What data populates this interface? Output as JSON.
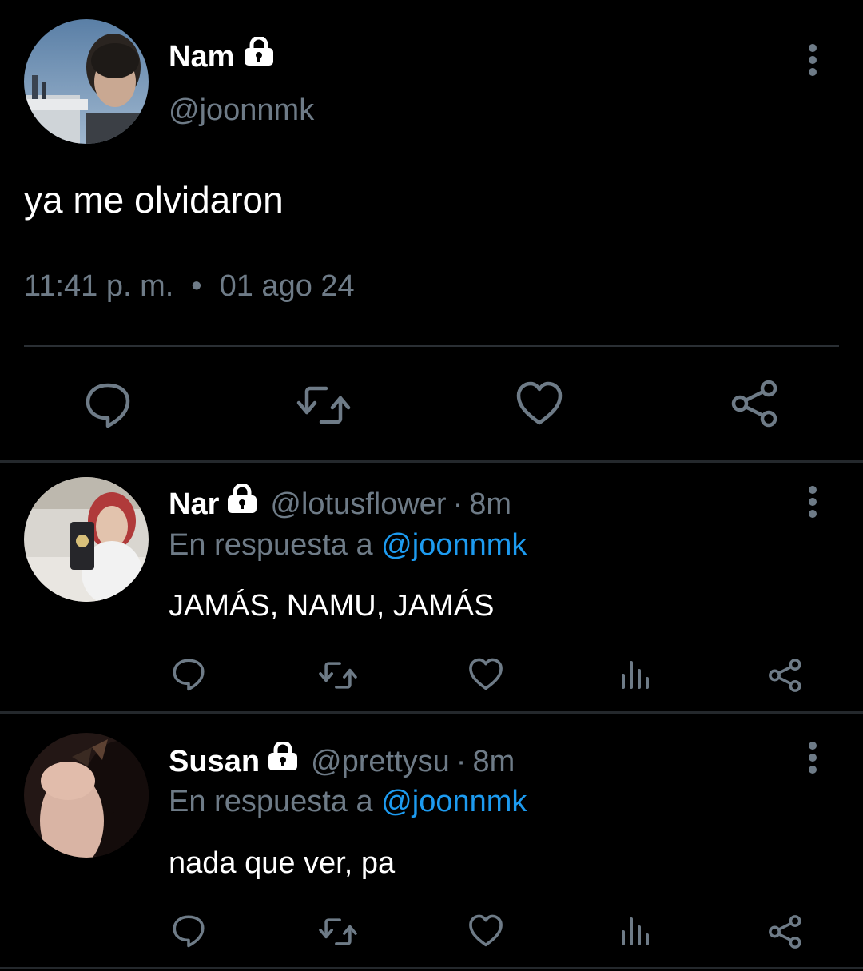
{
  "main_tweet": {
    "name": "Nam",
    "handle": "@joonnmk",
    "text": "ya me olvidaron",
    "time": "11:41 p. m.",
    "separator": "•",
    "date": "01 ago 24",
    "icons": {
      "lock": "lock-icon",
      "more": "more-vertical-icon",
      "reply": "reply-icon",
      "retweet": "retweet-icon",
      "like": "heart-icon",
      "share": "share-icon"
    }
  },
  "replies": [
    {
      "name": "Nar",
      "handle": "@lotusflower",
      "time_sep": "·",
      "time": "8m",
      "reply_prefix": "En respuesta a",
      "reply_mention": "@joonnmk",
      "text": "JAMÁS, NAMU, JAMÁS"
    },
    {
      "name": "Susan",
      "handle": "@prettysu",
      "time_sep": "·",
      "time": "8m",
      "reply_prefix": "En respuesta a",
      "reply_mention": "@joonnmk",
      "text": "nada que ver, pa"
    }
  ],
  "colors": {
    "background": "#000000",
    "text_primary": "#ffffff",
    "text_secondary": "#6e7b87",
    "mention": "#1d9bf0",
    "divider": "#2a2f34"
  }
}
